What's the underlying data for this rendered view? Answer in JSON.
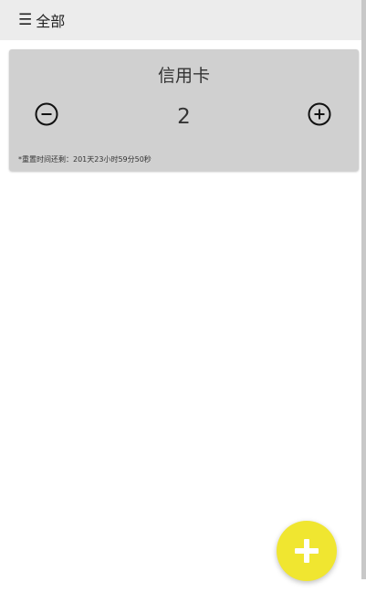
{
  "header": {
    "menu_icon": "☰",
    "category": "全部"
  },
  "card": {
    "title": "信用卡",
    "count": "2",
    "reset_note": "*重置时间还剩：201天23小时59分50秒"
  },
  "icons": {
    "minus": "minus-circle-icon",
    "plus": "plus-circle-icon",
    "fab": "plus-icon"
  },
  "colors": {
    "fab": "#f0e630",
    "card": "#d0d0d0",
    "topbar": "#ececec"
  }
}
